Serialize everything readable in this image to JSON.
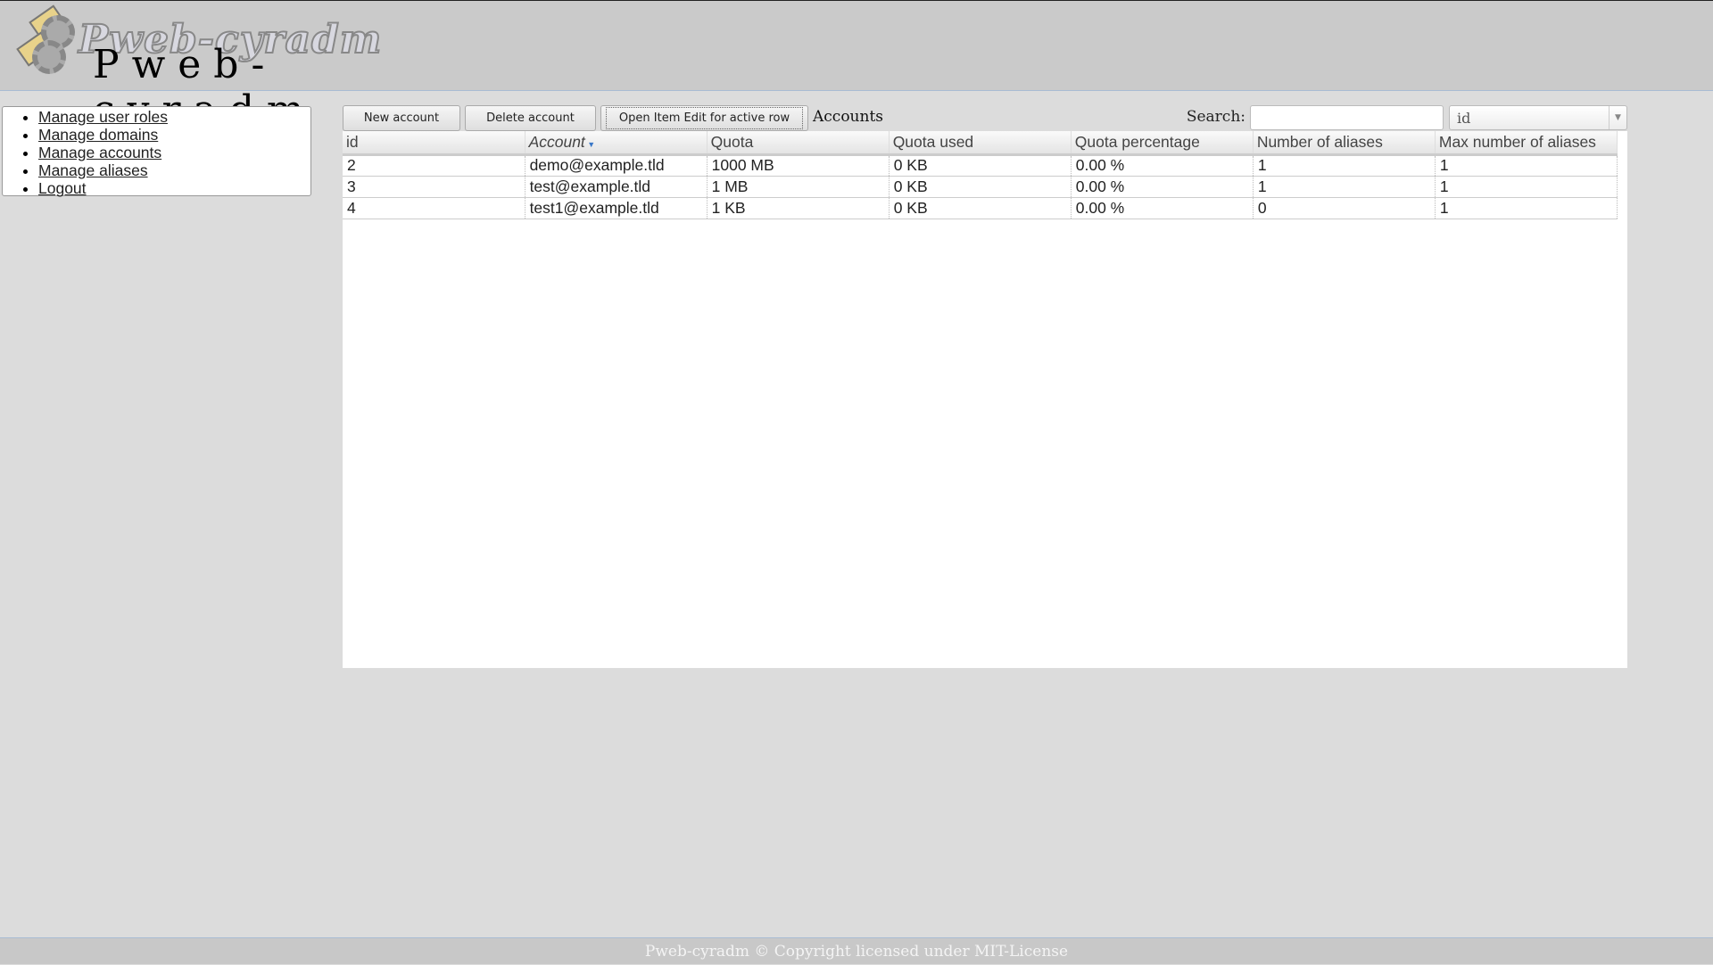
{
  "header": {
    "logo_text": "Pweb-cyradm"
  },
  "sidebar": {
    "items": [
      {
        "label": "Manage user roles"
      },
      {
        "label": "Manage domains"
      },
      {
        "label": "Manage accounts"
      },
      {
        "label": "Manage aliases"
      },
      {
        "label": "Logout"
      }
    ]
  },
  "toolbar": {
    "new_label": "New account",
    "delete_label": "Delete account",
    "edit_label": "Open Item Edit for active row",
    "title": "Accounts",
    "search_label": "Search:",
    "search_value": "",
    "search_field": "id"
  },
  "table": {
    "columns": [
      "id",
      "Account",
      "Quota",
      "Quota used",
      "Quota percentage",
      "Number of aliases",
      "Max number of aliases"
    ],
    "sorted_column": "Account",
    "rows": [
      [
        "2",
        "demo@example.tld",
        "1000 MB",
        "0 KB",
        "0.00 %",
        "1",
        "1"
      ],
      [
        "3",
        "test@example.tld",
        "1 MB",
        "0 KB",
        "0.00 %",
        "1",
        "1"
      ],
      [
        "4",
        "test1@example.tld",
        "1 KB",
        "0 KB",
        "0.00 %",
        "0",
        "1"
      ]
    ]
  },
  "footer": {
    "text": "Pweb-cyradm © Copyright licensed under MIT-License"
  }
}
